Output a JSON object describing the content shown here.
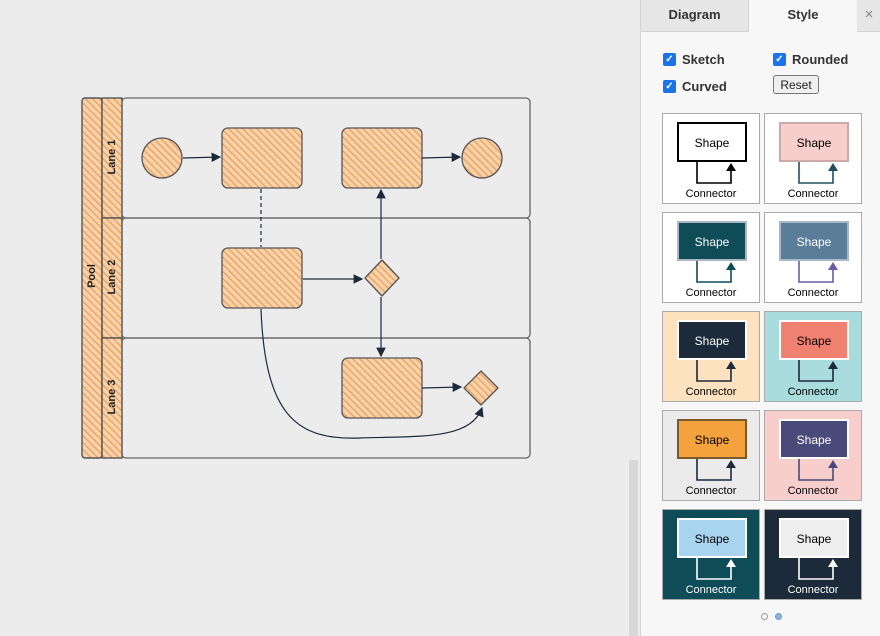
{
  "diagram": {
    "pool_label": "Pool",
    "lanes": [
      {
        "label": "Lane 1"
      },
      {
        "label": "Lane 2"
      },
      {
        "label": "Lane 3"
      }
    ],
    "fill_color": "#f2b27a",
    "stroke_color": "#555555"
  },
  "panel": {
    "tabs": [
      {
        "label": "Diagram",
        "active": false
      },
      {
        "label": "Style",
        "active": true
      }
    ],
    "close_label": "×",
    "options": {
      "sketch": {
        "label": "Sketch",
        "checked": true
      },
      "rounded": {
        "label": "Rounded",
        "checked": true
      },
      "curved": {
        "label": "Curved",
        "checked": true
      },
      "reset_label": "Reset"
    },
    "styles": [
      {
        "shape": "Shape",
        "connector": "Connector",
        "bg": "#ffffff",
        "fill": "#ffffff",
        "stroke": "#000000",
        "text": "#000000",
        "line": "#000000"
      },
      {
        "shape": "Shape",
        "connector": "Connector",
        "bg": "#ffffff",
        "fill": "#f8cecc",
        "stroke": "#c9a9a9",
        "text": "#000000",
        "line": "#1f4e5f"
      },
      {
        "shape": "Shape",
        "connector": "Connector",
        "bg": "#ffffff",
        "fill": "#0e4c58",
        "stroke": "#a9b8c0",
        "text": "#ffffff",
        "line": "#0e4c58"
      },
      {
        "shape": "Shape",
        "connector": "Connector",
        "bg": "#ffffff",
        "fill": "#5a7d9a",
        "stroke": "#a9b8c8",
        "text": "#ffffff",
        "line": "#6a5aa8"
      },
      {
        "shape": "Shape",
        "connector": "Connector",
        "bg": "#fde2c0",
        "fill": "#1c2a3a",
        "stroke": "#ffffff",
        "text": "#ffffff",
        "line": "#1c2a3a"
      },
      {
        "shape": "Shape",
        "connector": "Connector",
        "bg": "#a8dcdd",
        "fill": "#f08070",
        "stroke": "#ffffff",
        "text": "#000000",
        "line": "#1c2a3a"
      },
      {
        "shape": "Shape",
        "connector": "Connector",
        "bg": "#ebebeb",
        "fill": "#f4a23e",
        "stroke": "#7a5a2a",
        "text": "#000000",
        "line": "#1c2a3a"
      },
      {
        "shape": "Shape",
        "connector": "Connector",
        "bg": "#f8cecc",
        "fill": "#4a4a7a",
        "stroke": "#ffffff",
        "text": "#ffffff",
        "line": "#4a4a7a"
      },
      {
        "shape": "Shape",
        "connector": "Connector",
        "bg": "#0e4c58",
        "fill": "#a8d4f0",
        "stroke": "#ffffff",
        "text": "#000000",
        "line": "#ffffff"
      },
      {
        "shape": "Shape",
        "connector": "Connector",
        "bg": "#1c2a3a",
        "fill": "#eeeeee",
        "stroke": "#ffffff",
        "text": "#000000",
        "line": "#ffffff"
      }
    ],
    "pager": {
      "pages": 2,
      "current": 2
    }
  }
}
